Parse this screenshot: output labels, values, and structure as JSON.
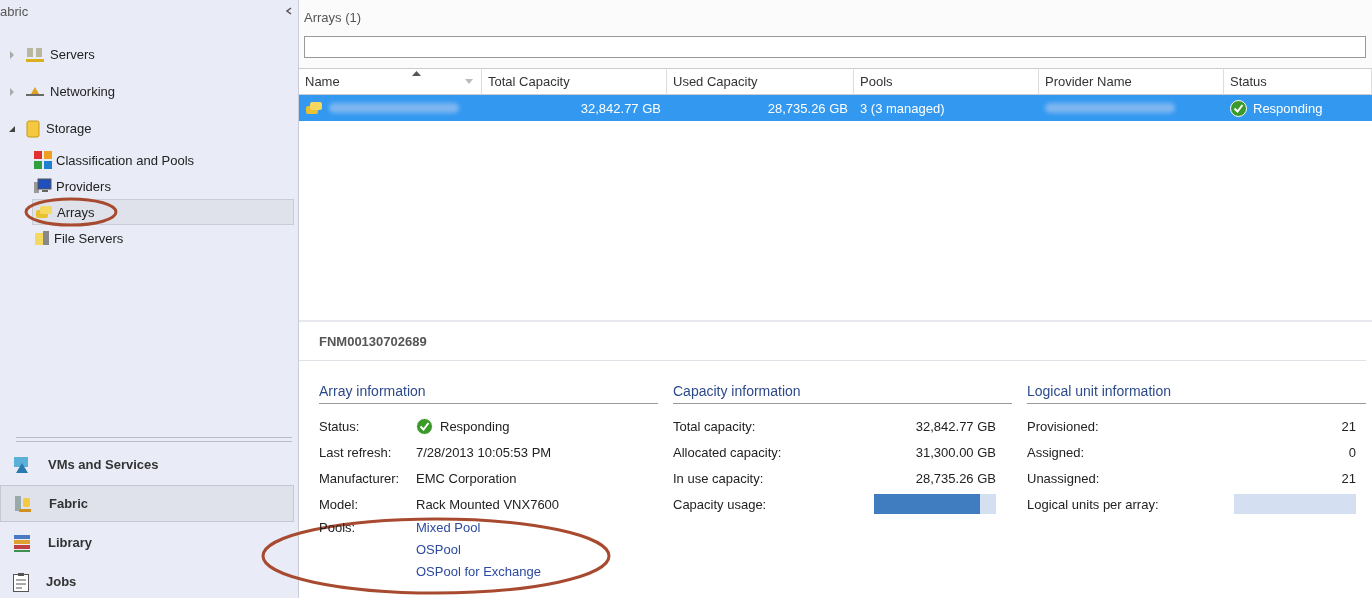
{
  "sidebar": {
    "title": "abric",
    "tree": [
      {
        "label": "Servers",
        "expanded": false
      },
      {
        "label": "Networking",
        "expanded": false
      },
      {
        "label": "Storage",
        "expanded": true,
        "children": [
          {
            "label": "Classification and Pools",
            "selected": false,
            "circled": false
          },
          {
            "label": "Providers",
            "selected": false,
            "circled": false
          },
          {
            "label": "Arrays",
            "selected": true,
            "circled": true
          },
          {
            "label": "File Servers",
            "selected": false,
            "circled": false
          }
        ]
      }
    ],
    "nav": [
      {
        "label": "VMs and Services",
        "selected": false
      },
      {
        "label": "Fabric",
        "selected": true
      },
      {
        "label": "Library",
        "selected": false
      },
      {
        "label": "Jobs",
        "selected": false
      }
    ]
  },
  "grid": {
    "title": "Arrays (1)",
    "columns": [
      "Name",
      "Total Capacity",
      "Used Capacity",
      "Pools",
      "Provider Name",
      "Status"
    ],
    "rows": [
      {
        "selected": true,
        "total_capacity": "32,842.77 GB",
        "used_capacity": "28,735.26 GB",
        "pools": "3 (3 managed)",
        "status": "Responding"
      }
    ]
  },
  "details": {
    "title": "FNM00130702689",
    "array_info": {
      "heading": "Array information",
      "status_label": "Status:",
      "status": "Responding",
      "refresh_label": "Last refresh:",
      "refresh": "7/28/2013 10:05:53 PM",
      "manufacturer_label": "Manufacturer:",
      "manufacturer": "EMC Corporation",
      "model_label": "Model:",
      "model": "Rack Mounted VNX7600",
      "pools_label": "Pools:",
      "pools": [
        "Mixed Pool",
        "OSPool",
        "OSPool for Exchange"
      ],
      "pools_circled": true
    },
    "capacity_info": {
      "heading": "Capacity information",
      "rows": [
        {
          "label": "Total capacity:",
          "value": "32,842.77 GB"
        },
        {
          "label": "Allocated capacity:",
          "value": "31,300.00 GB"
        },
        {
          "label": "In use capacity:",
          "value": "28,735.26 GB"
        }
      ],
      "usage_label": "Capacity usage:",
      "usage": {
        "level": 0.87
      }
    },
    "lun_info": {
      "heading": "Logical unit information",
      "rows": [
        {
          "label": "Provisioned:",
          "value": "21"
        },
        {
          "label": "Assigned:",
          "value": "0"
        },
        {
          "label": "Unassigned:",
          "value": "21"
        }
      ],
      "per_array_label": "Logical units per array:"
    }
  }
}
